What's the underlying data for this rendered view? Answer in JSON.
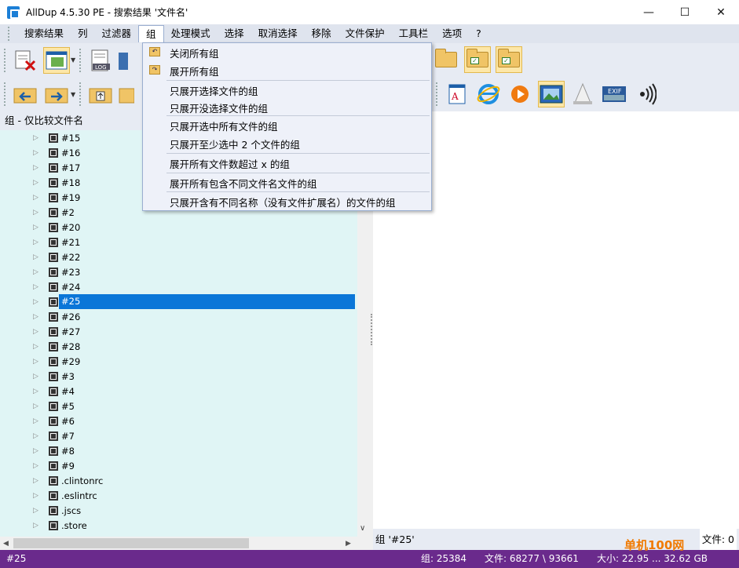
{
  "window": {
    "title": "AllDup 4.5.30 PE - 搜索结果 '文件名'",
    "minimize": "—",
    "maximize": "☐",
    "close": "✕"
  },
  "menubar": [
    "搜索结果",
    "列",
    "过滤器",
    "组",
    "处理模式",
    "选择",
    "取消选择",
    "移除",
    "文件保护",
    "工具栏",
    "选项",
    "?"
  ],
  "dropdown": {
    "items": [
      "关闭所有组",
      "展开所有组",
      "只展开选择文件的组",
      "只展开没选择文件的组",
      "只展开选中所有文件的组",
      "只展开至少选中 2 个文件的组",
      "展开所有文件数超过 x 的组",
      "展开所有包含不同文件名文件的组",
      "只展开含有不同名称（没有文件扩展名）的文件的组"
    ]
  },
  "toolbar1": {
    "log_label": "LOG"
  },
  "toolbar2": {
    "exif_label": "EXIF"
  },
  "left_panel": {
    "header": "组 - 仅比较文件名",
    "rows": [
      "#15",
      "#16",
      "#17",
      "#18",
      "#19",
      "#2",
      "#20",
      "#21",
      "#22",
      "#23",
      "#24",
      "#25",
      "#26",
      "#27",
      "#28",
      "#29",
      "#3",
      "#4",
      "#5",
      "#6",
      "#7",
      "#8",
      "#9",
      ".clintonrc",
      ".eslintrc",
      ".jscs",
      ".store"
    ],
    "selected": "#25"
  },
  "right_panel": {
    "group_label": "组 '#25'",
    "file_label": "文件: 0"
  },
  "statusbar": {
    "current": "#25",
    "groups": "组: 25384",
    "files": "文件: 68277 \\ 93661",
    "size": "大小: 22.95 ... 32.62 GB"
  },
  "watermark": "单机100网"
}
